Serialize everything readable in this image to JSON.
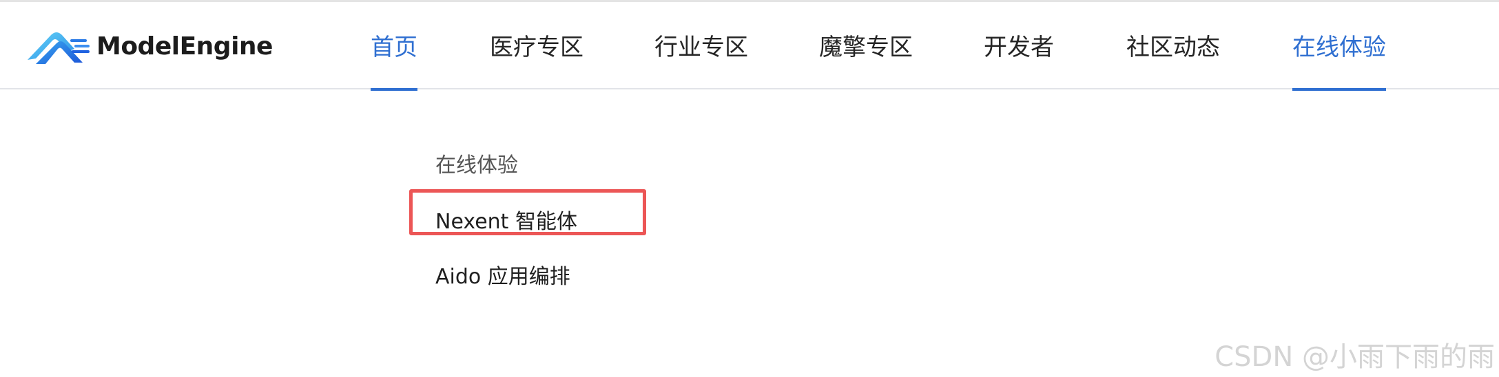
{
  "header": {
    "brand": "ModelEngine",
    "nav": [
      {
        "label": "首页",
        "active": true
      },
      {
        "label": "医疗专区",
        "active": false
      },
      {
        "label": "行业专区",
        "active": false
      },
      {
        "label": "魔擎专区",
        "active": false
      },
      {
        "label": "开发者",
        "active": false
      },
      {
        "label": "社区动态",
        "active": false
      },
      {
        "label": "在线体验",
        "active": true
      }
    ]
  },
  "dropdown": {
    "title": "在线体验",
    "items": [
      {
        "label": "Nexent 智能体",
        "highlighted": true
      },
      {
        "label": "Aido 应用编排",
        "highlighted": false
      }
    ]
  },
  "watermark": "CSDN @小雨下雨的雨",
  "colors": {
    "accent": "#2f6fd1",
    "highlight_border": "#ec5656",
    "logo_light": "#53c6f5",
    "logo_dark": "#1f62e0"
  },
  "icons": {
    "logo": "modelengine-logo-icon"
  }
}
